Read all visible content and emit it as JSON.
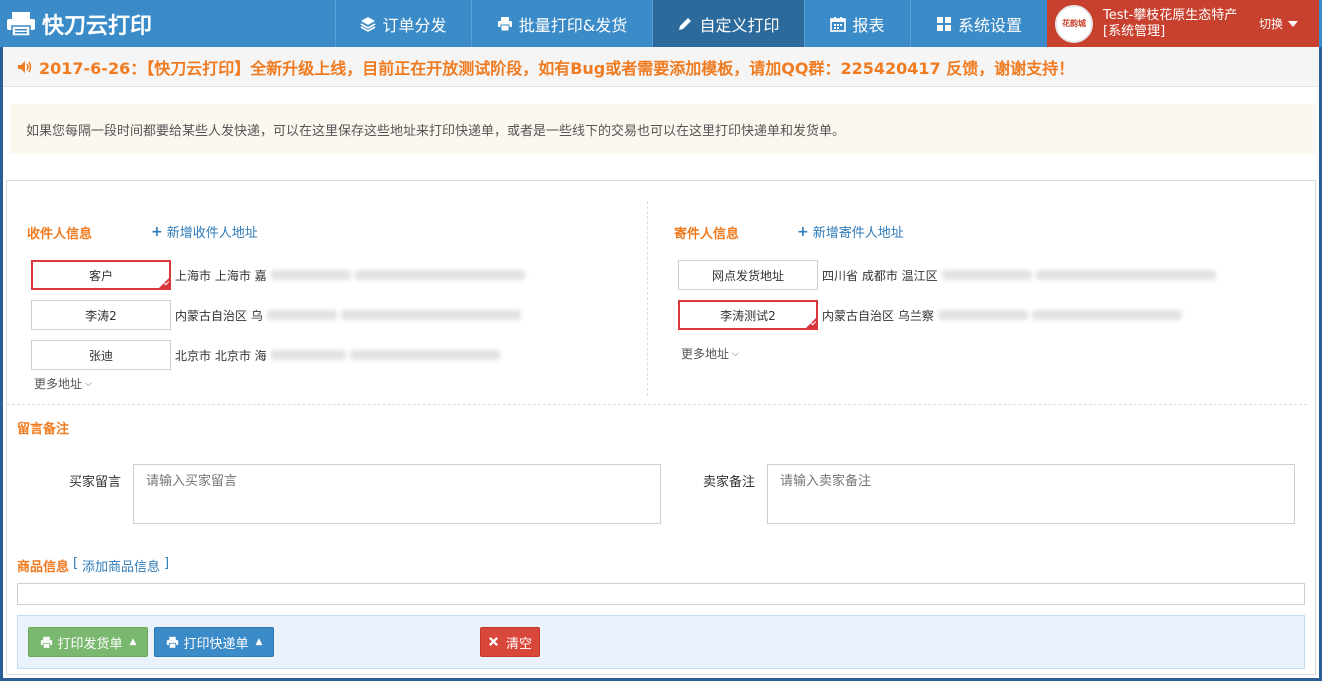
{
  "app": {
    "title": "快刀云打印"
  },
  "nav": [
    {
      "label": "订单分发",
      "icon": "layers-icon"
    },
    {
      "label": "批量打印&发货",
      "icon": "printer-icon"
    },
    {
      "label": "自定义打印",
      "icon": "pencil-icon"
    },
    {
      "label": "报表",
      "icon": "calendar-icon"
    },
    {
      "label": "系统设置",
      "icon": "grid-icon"
    }
  ],
  "user": {
    "avatar_text": "花韵城",
    "name_line1": "Test-攀枝花原生态特产",
    "name_line2": "[系统管理]",
    "switch_label": "切换"
  },
  "notice": {
    "text": "2017-6-26：【快刀云打印】全新升级上线，目前正在开放测试阶段，如有Bug或者需要添加模板，请加QQ群：225420417 反馈，谢谢支持！"
  },
  "tip": {
    "text": "如果您每隔一段时间都要给某些人发快递，可以在这里保存这些地址来打印快递单，或者是一些线下的交易也可以在这里打印快递单和发货单。"
  },
  "receiver": {
    "title": "收件人信息",
    "add_label": "新增收件人地址",
    "items": [
      {
        "name": "客户",
        "address": "上海市 上海市 嘉",
        "selected": true
      },
      {
        "name": "李涛2",
        "address": "内蒙古自治区 乌",
        "selected": false
      },
      {
        "name": "张迪",
        "address": "北京市 北京市 海",
        "selected": false
      }
    ],
    "more_label": "更多地址"
  },
  "sender": {
    "title": "寄件人信息",
    "add_label": "新增寄件人地址",
    "items": [
      {
        "name": "网点发货地址",
        "address": "四川省 成都市 温江区",
        "selected": false
      },
      {
        "name": "李涛测试2",
        "address": "内蒙古自治区 乌兰察",
        "selected": true
      }
    ],
    "more_label": "更多地址"
  },
  "remarks": {
    "title": "留言备注",
    "buyer_label": "买家留言",
    "buyer_placeholder": "请输入买家留言",
    "seller_label": "卖家备注",
    "seller_placeholder": "请输入卖家备注"
  },
  "goods": {
    "title": "商品信息",
    "add_label": "添加商品信息",
    "bracket_open": "[",
    "bracket_close": "]"
  },
  "actions": {
    "print_invoice": "打印发货单",
    "print_express": "打印快递单",
    "clear": "清空"
  },
  "colors": {
    "nav_bg": "#3a8bc8",
    "nav_active": "#2c6a9c",
    "user_bg": "#c8412f",
    "accent_orange": "#f07b20",
    "link_blue": "#2e7bb8",
    "selected_red": "#d9363e"
  }
}
